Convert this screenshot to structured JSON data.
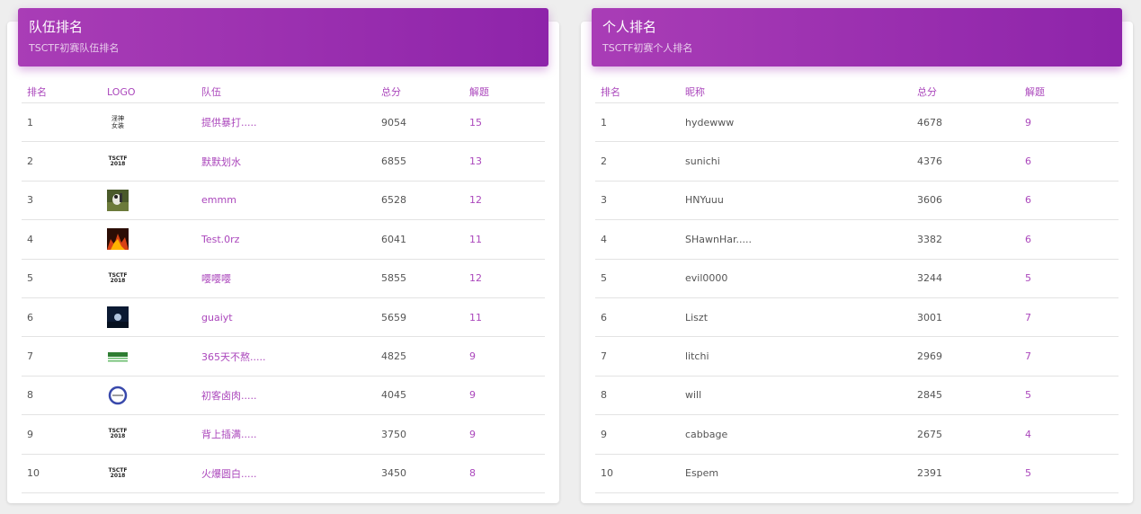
{
  "teams_card": {
    "title": "队伍排名",
    "subtitle": "TSCTF初赛队伍排名",
    "columns": {
      "rank": "排名",
      "logo": "LOGO",
      "team": "队伍",
      "score": "总分",
      "solved": "解题"
    },
    "rows": [
      {
        "rank": "1",
        "logo_text": "淫神\n女装",
        "logo_type": "text-big",
        "team": "提供暴打.....",
        "score": "9054",
        "solved": "15"
      },
      {
        "rank": "2",
        "logo_text": "TSCTF\n2018",
        "logo_type": "text",
        "team": "默默划水",
        "score": "6855",
        "solved": "13"
      },
      {
        "rank": "3",
        "logo_text": "",
        "logo_type": "img-bird",
        "team": "emmm",
        "score": "6528",
        "solved": "12"
      },
      {
        "rank": "4",
        "logo_text": "",
        "logo_type": "img-fire",
        "team": "Test.0rz",
        "score": "6041",
        "solved": "11"
      },
      {
        "rank": "5",
        "logo_text": "TSCTF\n2018",
        "logo_type": "text",
        "team": "嘤嘤嘤",
        "score": "5855",
        "solved": "12"
      },
      {
        "rank": "6",
        "logo_text": "",
        "logo_type": "img-night",
        "team": "guaiyt",
        "score": "5659",
        "solved": "11"
      },
      {
        "rank": "7",
        "logo_text": "",
        "logo_type": "img-green",
        "team": "365天不熬.....",
        "score": "4825",
        "solved": "9"
      },
      {
        "rank": "8",
        "logo_text": "",
        "logo_type": "img-ring",
        "team": "初客卤肉.....",
        "score": "4045",
        "solved": "9"
      },
      {
        "rank": "9",
        "logo_text": "TSCTF\n2018",
        "logo_type": "text",
        "team": "背上插满.....",
        "score": "3750",
        "solved": "9"
      },
      {
        "rank": "10",
        "logo_text": "TSCTF\n2018",
        "logo_type": "text",
        "team": "火爆圆白.....",
        "score": "3450",
        "solved": "8"
      }
    ]
  },
  "players_card": {
    "title": "个人排名",
    "subtitle": "TSCTF初赛个人排名",
    "columns": {
      "rank": "排名",
      "nickname": "昵称",
      "score": "总分",
      "solved": "解题"
    },
    "rows": [
      {
        "rank": "1",
        "nickname": "hydewww",
        "score": "4678",
        "solved": "9"
      },
      {
        "rank": "2",
        "nickname": "sunichi",
        "score": "4376",
        "solved": "6"
      },
      {
        "rank": "3",
        "nickname": "HNYuuu",
        "score": "3606",
        "solved": "6"
      },
      {
        "rank": "4",
        "nickname": "SHawnHar.....",
        "score": "3382",
        "solved": "6"
      },
      {
        "rank": "5",
        "nickname": "evil0000",
        "score": "3244",
        "solved": "5"
      },
      {
        "rank": "6",
        "nickname": "Liszt",
        "score": "3001",
        "solved": "7"
      },
      {
        "rank": "7",
        "nickname": "litchi",
        "score": "2969",
        "solved": "7"
      },
      {
        "rank": "8",
        "nickname": "will",
        "score": "2845",
        "solved": "5"
      },
      {
        "rank": "9",
        "nickname": "cabbage",
        "score": "2675",
        "solved": "4"
      },
      {
        "rank": "10",
        "nickname": "Espem",
        "score": "2391",
        "solved": "5"
      }
    ]
  },
  "colors": {
    "accent": "#ab47bc",
    "header_start": "#a93db6",
    "header_end": "#8e24aa"
  }
}
